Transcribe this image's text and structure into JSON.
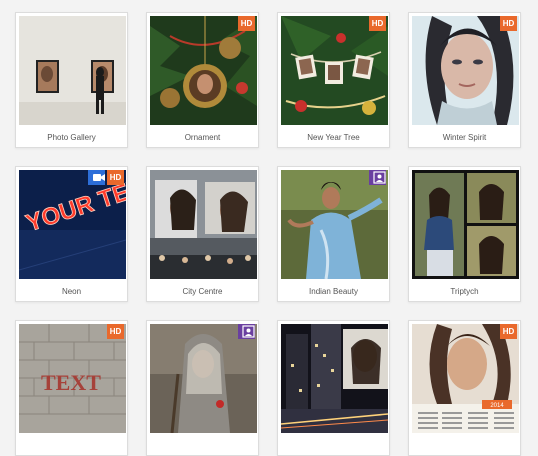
{
  "gallery": {
    "items": [
      {
        "label": "Photo Gallery",
        "badge": ""
      },
      {
        "label": "Ornament",
        "badge": "HD"
      },
      {
        "label": "New Year Tree",
        "badge": "HD"
      },
      {
        "label": "Winter Spirit",
        "badge": "HD"
      },
      {
        "label": "Neon",
        "badge": "HD",
        "thumb_text": "YOUR TEXT"
      },
      {
        "label": "City Centre",
        "badge": ""
      },
      {
        "label": "Indian Beauty",
        "badge": ""
      },
      {
        "label": "Triptych",
        "badge": ""
      },
      {
        "label": "",
        "badge": "HD",
        "thumb_text": "TEXT"
      },
      {
        "label": "",
        "badge": ""
      },
      {
        "label": "",
        "badge": ""
      },
      {
        "label": "",
        "badge": "HD",
        "calendar_year": "2014"
      }
    ]
  },
  "icons": {
    "hd": "hd-badge-icon",
    "video": "video-camera-icon",
    "face": "face-frame-icon"
  },
  "colors": {
    "hd_badge": "#e9692c",
    "video_badge": "#2d6ed8",
    "face_badge": "#6a3fa0",
    "background": "#f3f3f3"
  }
}
